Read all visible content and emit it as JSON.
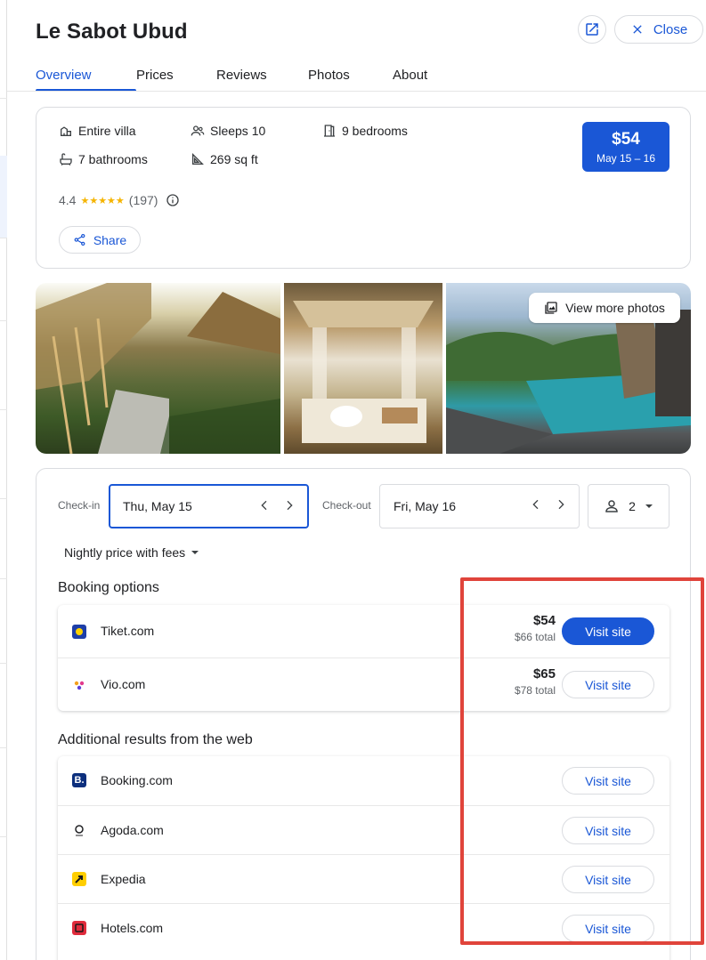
{
  "hotel": {
    "title": "Le Sabot Ubud",
    "close_label": "Close"
  },
  "tabs": [
    {
      "label": "Overview"
    },
    {
      "label": "Prices"
    },
    {
      "label": "Reviews"
    },
    {
      "label": "Photos"
    },
    {
      "label": "About"
    }
  ],
  "features": {
    "villa": "Entire villa",
    "sleeps": "Sleeps 10",
    "bedrooms": "9 bedrooms",
    "bathrooms": "7 bathrooms",
    "area": "269 sq ft"
  },
  "rating": {
    "score": "4.4",
    "stars": "★★★★★",
    "count": "(197)",
    "fill_fraction": 0.88
  },
  "share_label": "Share",
  "price_box": {
    "price": "$54",
    "dates": "May 15 – 16"
  },
  "photos": {
    "view_more_label": "View more photos"
  },
  "booking_form": {
    "checkin_label": "Check-in",
    "checkin_value": "Thu, May 15",
    "checkout_label": "Check-out",
    "checkout_value": "Fri, May 16",
    "guests": "2",
    "nightly_label": "Nightly price with fees"
  },
  "booking_options": {
    "heading": "Booking options",
    "items": [
      {
        "name": "Tiket.com",
        "price": "$54",
        "total": "$66 total",
        "button": "Visit site"
      },
      {
        "name": "Vio.com",
        "price": "$65",
        "total": "$78 total",
        "button": "Visit site"
      }
    ]
  },
  "additional": {
    "heading": "Additional results from the web",
    "items": [
      {
        "name": "Booking.com",
        "button": "Visit site"
      },
      {
        "name": "Agoda.com",
        "button": "Visit site"
      },
      {
        "name": "Expedia",
        "button": "Visit site"
      },
      {
        "name": "Hotels.com",
        "button": "Visit site"
      }
    ]
  },
  "colors": {
    "accent": "#1a57d6",
    "annotation": "#e0443b"
  },
  "icons": [
    "external-link-icon",
    "close-icon",
    "villa-icon",
    "people-icon",
    "door-icon",
    "bathtub-icon",
    "ruler-icon",
    "info-icon",
    "share-icon",
    "gallery-icon",
    "chevron-left-icon",
    "chevron-right-icon",
    "person-icon",
    "dropdown-icon"
  ]
}
